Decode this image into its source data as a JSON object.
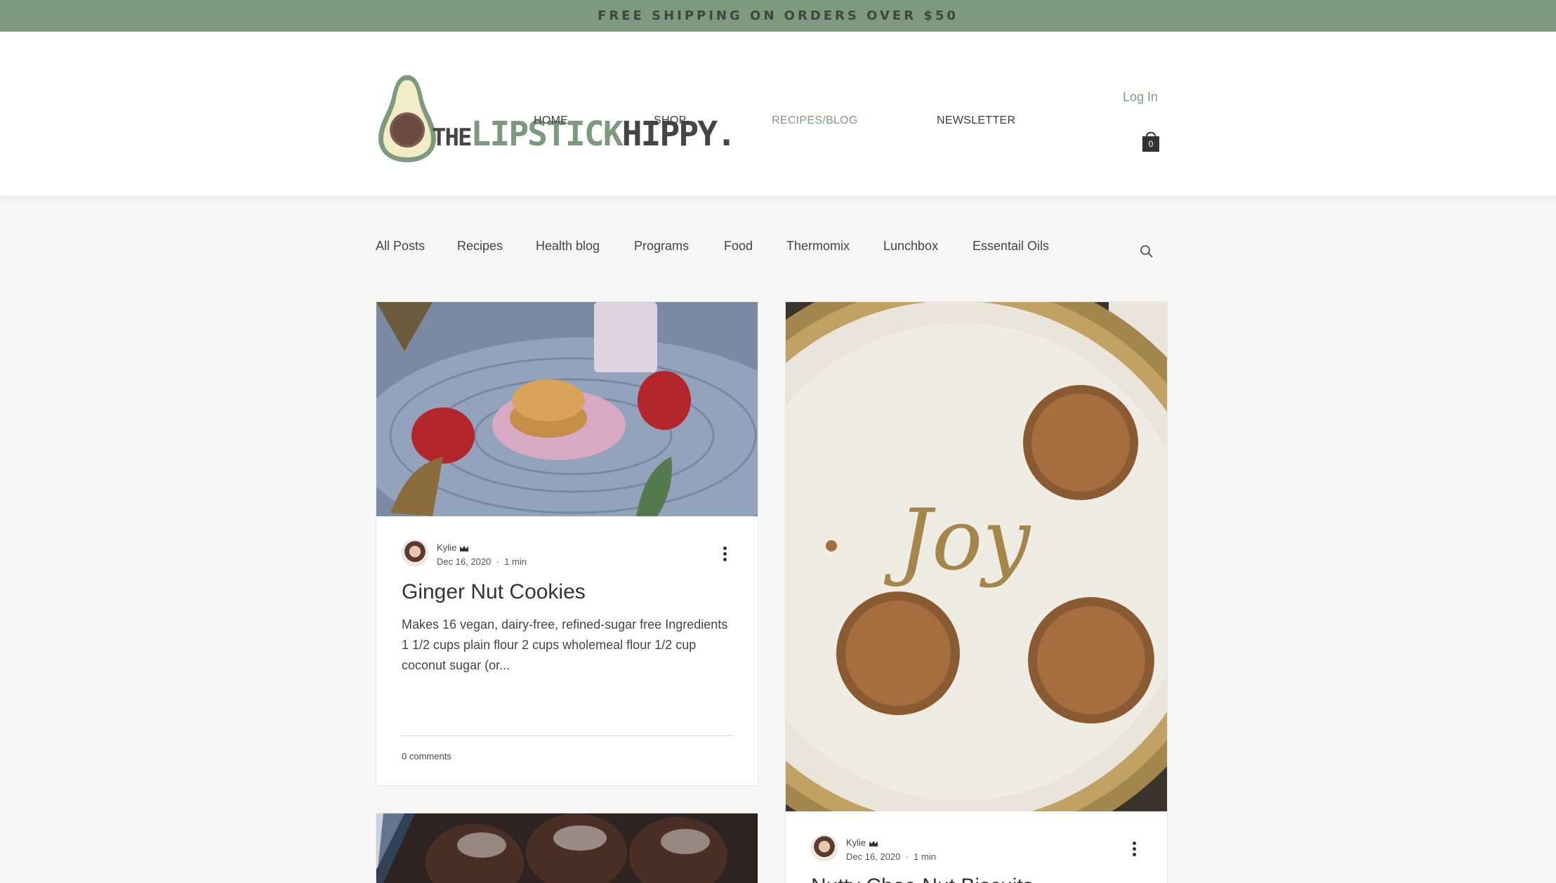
{
  "promo": {
    "text": "FREE SHIPPING ON ORDERS OVER $50"
  },
  "brand": {
    "the": "THE",
    "lipstick": "LIPSTICK",
    "hippy": "HIPPY."
  },
  "nav": [
    {
      "label": "HOME",
      "active": false
    },
    {
      "label": "SHOP",
      "active": false
    },
    {
      "label": "RECIPES/BLOG",
      "active": true
    },
    {
      "label": "NEWSLETTER",
      "active": false
    }
  ],
  "account": {
    "login_label": "Log In",
    "cart_count": "0"
  },
  "categories": [
    "All Posts",
    "Recipes",
    "Health blog",
    "Programs",
    "Food",
    "Thermomix",
    "Lunchbox",
    "Essentail Oils"
  ],
  "posts": [
    {
      "author": "Kylie",
      "date": "Dec 16, 2020",
      "separator": "·",
      "read_time": "1 min",
      "title": "Ginger Nut Cookies",
      "excerpt": "Makes 16 vegan, dairy-free, refined-sugar free Ingredients 1 1/2 cups plain flour 2 cups wholemeal flour 1/2 cup coconut sugar (or...",
      "comments": "0 comments"
    },
    {
      "author": "Kylie",
      "date": "Dec 16, 2020",
      "separator": "·",
      "read_time": "1 min",
      "title": "Nutty Choc-Nut Biscuits",
      "image_text": "Joy"
    }
  ],
  "colors": {
    "accent": "#7d9a7e",
    "banner_text": "#3d4740",
    "text": "#333333"
  }
}
